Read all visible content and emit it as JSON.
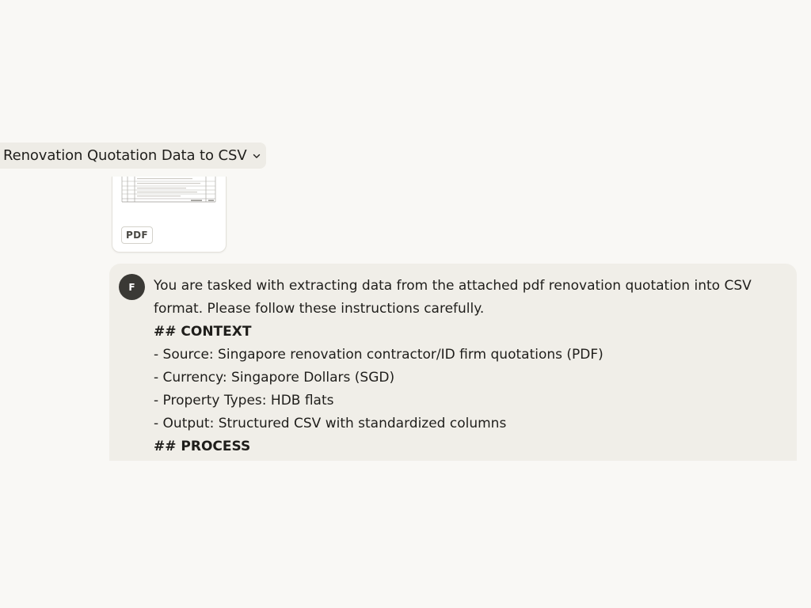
{
  "chat": {
    "title": "Renovation Quotation Data to CSV",
    "title_menu_icon": "chevron-down-icon"
  },
  "attachment": {
    "type_label": "PDF",
    "thumbnail_icon": "document-table-thumbnail"
  },
  "message": {
    "avatar_initial": "F",
    "lines": [
      "You are tasked with extracting data from the attached pdf renovation quotation into CSV",
      "format. Please follow these instructions carefully.",
      "## CONTEXT",
      "- Source: Singapore renovation contractor/ID firm quotations (PDF)",
      "- Currency: Singapore Dollars (SGD)",
      "- Property Types: HDB flats",
      "- Output: Structured CSV with standardized columns",
      "## PROCESS"
    ]
  },
  "colors": {
    "page_background": "#f9f8f5",
    "message_background": "#f0eee8",
    "title_chip_background": "#eeece6",
    "avatar_background": "#3a3935"
  }
}
